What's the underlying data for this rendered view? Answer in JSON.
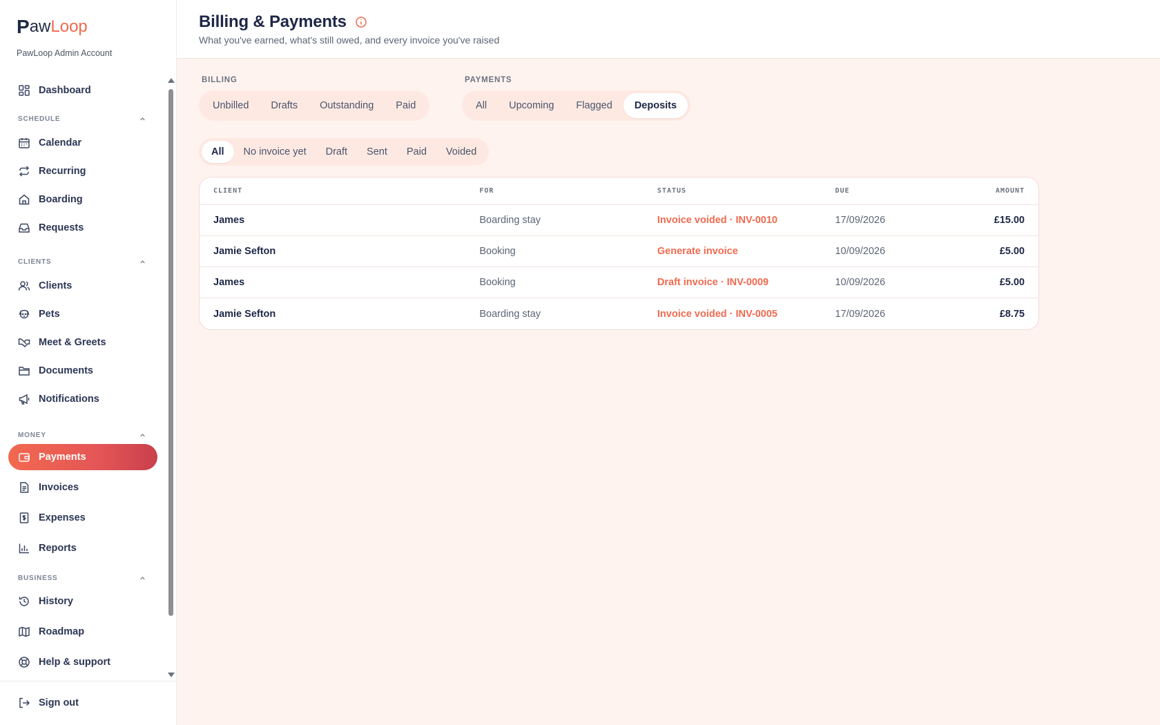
{
  "brand": {
    "p": "P",
    "aw": "aw",
    "loop": "Loop",
    "account": "PawLoop Admin Account"
  },
  "sidebar": {
    "dashboard": "Dashboard",
    "schedule": {
      "label": "SCHEDULE",
      "items": [
        "Calendar",
        "Recurring",
        "Boarding",
        "Requests"
      ]
    },
    "clients": {
      "label": "CLIENTS",
      "items": [
        "Clients",
        "Pets",
        "Meet & Greets",
        "Documents",
        "Notifications"
      ]
    },
    "money": {
      "label": "MONEY",
      "items": [
        "Payments",
        "Invoices",
        "Expenses",
        "Reports"
      ]
    },
    "business": {
      "label": "BUSINESS",
      "items": [
        "History",
        "Roadmap",
        "Help & support"
      ]
    },
    "signout": "Sign out"
  },
  "header": {
    "title": "Billing & Payments",
    "subtitle": "What you've earned, what's still owed, and every invoice you've raised"
  },
  "billing": {
    "label": "BILLING",
    "tabs": [
      "Unbilled",
      "Drafts",
      "Outstanding",
      "Paid"
    ]
  },
  "payments": {
    "label": "PAYMENTS",
    "tabs": [
      "All",
      "Upcoming",
      "Flagged",
      "Deposits"
    ],
    "active": "Deposits"
  },
  "status_filter": {
    "tabs": [
      "All",
      "No invoice yet",
      "Draft",
      "Sent",
      "Paid",
      "Voided"
    ],
    "active": "All"
  },
  "table": {
    "columns": [
      "CLIENT",
      "FOR",
      "STATUS",
      "DUE",
      "AMOUNT"
    ],
    "rows": [
      {
        "client": "James",
        "for": "Boarding stay",
        "status": "Invoice voided · INV-0010",
        "due": "17/09/2026",
        "amount": "£15.00"
      },
      {
        "client": "Jamie Sefton",
        "for": "Booking",
        "status": "Generate invoice",
        "due": "10/09/2026",
        "amount": "£5.00"
      },
      {
        "client": "James",
        "for": "Booking",
        "status": "Draft invoice · INV-0009",
        "due": "10/09/2026",
        "amount": "£5.00"
      },
      {
        "client": "Jamie Sefton",
        "for": "Boarding stay",
        "status": "Invoice voided · INV-0005",
        "due": "17/09/2026",
        "amount": "£8.75"
      }
    ]
  },
  "colors": {
    "accent": "#f06a4f",
    "page_bg": "#fff3ef",
    "pill_bg": "#fde9e2",
    "text": "#1d2747"
  }
}
